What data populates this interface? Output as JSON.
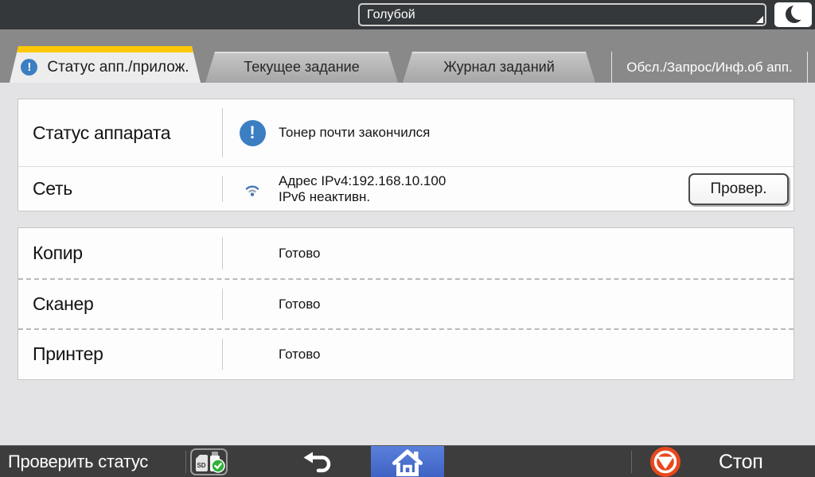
{
  "icons": {
    "alert_glyph": "!"
  },
  "top_bar": {
    "screen_color_value": "Голубой"
  },
  "tab_bar": {
    "tabs": [
      {
        "label": "Статус апп./прилож."
      },
      {
        "label": "Текущее задание"
      },
      {
        "label": "Журнал заданий"
      }
    ],
    "right_label": "Обсл./Запрос/Инф.об апп."
  },
  "machine_status_panel": {
    "status_row": {
      "label": "Статус аппарата",
      "value": "Тонер почти закончился"
    },
    "network_row": {
      "label": "Сеть",
      "line1": "Адрес IPv4:192.168.10.100",
      "line2": "IPv6 неактивн.",
      "button_label": "Провер."
    }
  },
  "apps_panel": {
    "rows": [
      {
        "label": "Копир",
        "value": "Готово"
      },
      {
        "label": "Сканер",
        "value": "Готово"
      },
      {
        "label": "Принтер",
        "value": "Готово"
      }
    ]
  },
  "bottom_bar": {
    "check_status_label": "Проверить статус",
    "stop_label": "Стоп"
  },
  "colors": {
    "accent_yellow": "#fec708",
    "alert_blue": "#3b7ec2",
    "home_blue": "#4a6fd0",
    "stop_orange": "#e8481b",
    "check_green": "#2fb03a"
  }
}
